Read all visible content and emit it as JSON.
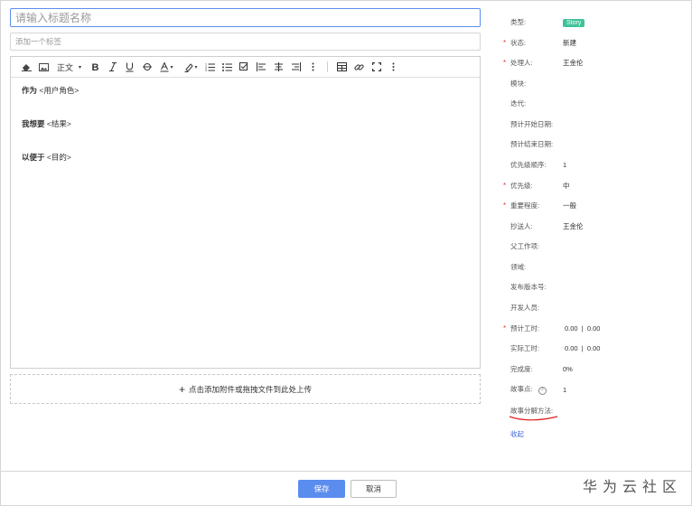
{
  "form": {
    "title_placeholder": "请输入标题名称",
    "tag_placeholder": "添加一个标签"
  },
  "toolbar": {
    "paragraph_label": "正文"
  },
  "editor": {
    "line1_bold": "作为",
    "line1_rest": " <用户角色>",
    "line2_bold": "我想要",
    "line2_rest": " <结果>",
    "line3_bold": "以便于",
    "line3_rest": " <目的>"
  },
  "upload": {
    "icon": "+",
    "label": "点击添加附件或拖拽文件到此处上传"
  },
  "sidebar": {
    "type_label": "类型:",
    "type_value": "Story",
    "type_color": "#3fc29a",
    "status_label": "状态:",
    "status_value": "新建",
    "handler_label": "处理人:",
    "handler_value": "王金伦",
    "module_label": "模块:",
    "iteration_label": "迭代:",
    "plan_start_label": "预计开始日期:",
    "plan_end_label": "预计结束日期:",
    "priority_order_label": "优先级顺序:",
    "priority_order_value": "1",
    "priority_label": "优先级:",
    "priority_value": "中",
    "importance_label": "重要程度:",
    "importance_value": "一般",
    "cc_label": "抄送人:",
    "cc_value": "王金伦",
    "parent_label": "父工作项:",
    "domain_label": "领域:",
    "release_label": "发布版本号:",
    "developer_label": "开发人员:",
    "est_hours_label": "预计工时:",
    "est_hours_value": "0.00  |  0.00",
    "actual_hours_label": "实际工时:",
    "actual_hours_value": "0.00  |  0.00",
    "completion_label": "完成度:",
    "completion_value": "0%",
    "story_points_label": "故事点:",
    "story_points_help": "?",
    "story_points_value": "1",
    "decompose_label": "故事分解方法:",
    "collapse_label": "收起"
  },
  "footer": {
    "save_label": "保存",
    "cancel_label": "取消",
    "watermark": "华为云社区"
  },
  "colors": {
    "primary": "#5b8def",
    "required": "#e0393e",
    "link": "#3f6ad8",
    "annotation": "#e02020"
  }
}
